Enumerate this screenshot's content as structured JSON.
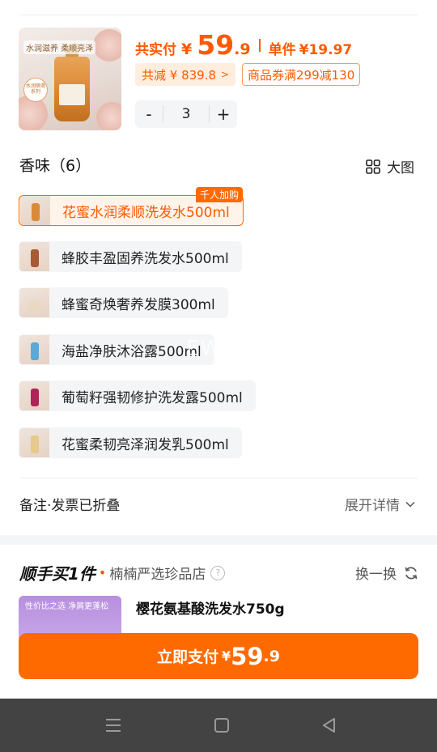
{
  "product": {
    "price_label": "共实付",
    "currency": "¥",
    "price_int": "59",
    "price_dec": ".9",
    "unit_label": "单件",
    "unit_price": "¥19.97",
    "discount": "共减 ¥ 839.8",
    "discount_arrow": ">",
    "coupon": "商品券满299减130",
    "quantity": "3",
    "minus": "-",
    "plus": "+",
    "thumb_slogan": "水润滋养 柔顺亮泽",
    "thumb_tag": "水润顺滑系列"
  },
  "variants": {
    "title": "香味（6）",
    "big_view": "大图",
    "hot_tag": "千人加购",
    "items": [
      {
        "label": "花蜜水润柔顺洗发水500ml"
      },
      {
        "label": "蜂胶丰盈固养洗发水500ml"
      },
      {
        "label": "蜂蜜奇焕奢养发膜300ml"
      },
      {
        "label": "海盐净肤沐浴露500ml"
      },
      {
        "label": "葡萄籽强韧修护洗发露500ml"
      },
      {
        "label": "花蜜柔韧亮泽润发乳500ml"
      }
    ]
  },
  "watermark": "EWDHUSA",
  "remark": {
    "label": "备注·发票已折叠",
    "expand": "展开详情"
  },
  "bundle": {
    "title": "顺手买1件",
    "dot": "•",
    "shop": "楠楠严选珍品店",
    "help": "?",
    "swap": "换一换",
    "rec_name": "樱花氨基酸洗发水750g",
    "rec_thumb_text": "性价比之选 净屑更蓬松"
  },
  "pay": {
    "label": "立即支付",
    "currency": "¥",
    "int": "59",
    "dec": ".9"
  },
  "colors": {
    "accent": "#ff6a00",
    "navbar": "#434343",
    "chip_bg": "#f4f5f7"
  }
}
